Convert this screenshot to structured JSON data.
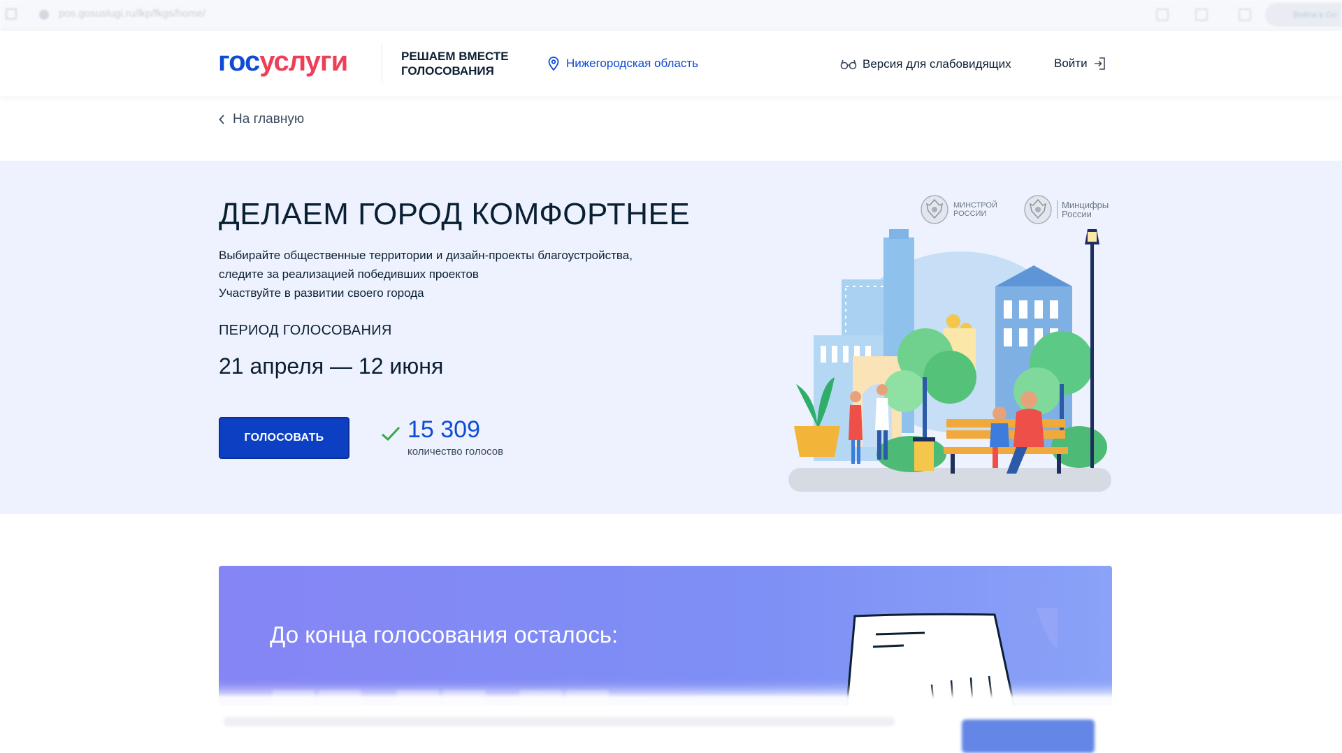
{
  "browser": {
    "url": "pos.gosuslugi.ru/lkp/fkgs/home/",
    "profile_label": "Войти в Go"
  },
  "header": {
    "logo_part1": "гос",
    "logo_part2": "услуги",
    "tagline_line1": "РЕШАЕМ ВМЕСТЕ",
    "tagline_line2": "ГОЛОСОВАНИЯ",
    "region": "Нижегородская область",
    "accessibility_label": "Версия для слабовидящих",
    "login_label": "Войти"
  },
  "nav": {
    "back_label": "На главную"
  },
  "hero": {
    "title": "ДЕЛАЕМ ГОРОД КОМФОРТНЕЕ",
    "desc_line1": "Выбирайте общественные территории и дизайн-проекты благоустройства,",
    "desc_line2": "следите за реализацией победивших проектов",
    "desc_line3": "Участвуйте в развитии своего города",
    "period_label": "ПЕРИОД ГОЛОСОВАНИЯ",
    "period_dates": "21 апреля — 12 июня",
    "vote_button": "ГОЛОСОВАТЬ",
    "votes_count": "15 309",
    "votes_label": "количество голосов",
    "partner1_line1": "МИНСТРОЙ",
    "partner1_line2": "РОССИИ",
    "partner2_line1": "Минцифры",
    "partner2_line2": "России"
  },
  "countdown": {
    "title": "До конца голосования осталось:"
  },
  "colors": {
    "brand_blue": "#0d4cd3",
    "brand_red": "#ee3f58",
    "button_blue": "#0d3fc2",
    "hero_bg": "#edf2fe",
    "banner_purple": "#8585f5"
  }
}
